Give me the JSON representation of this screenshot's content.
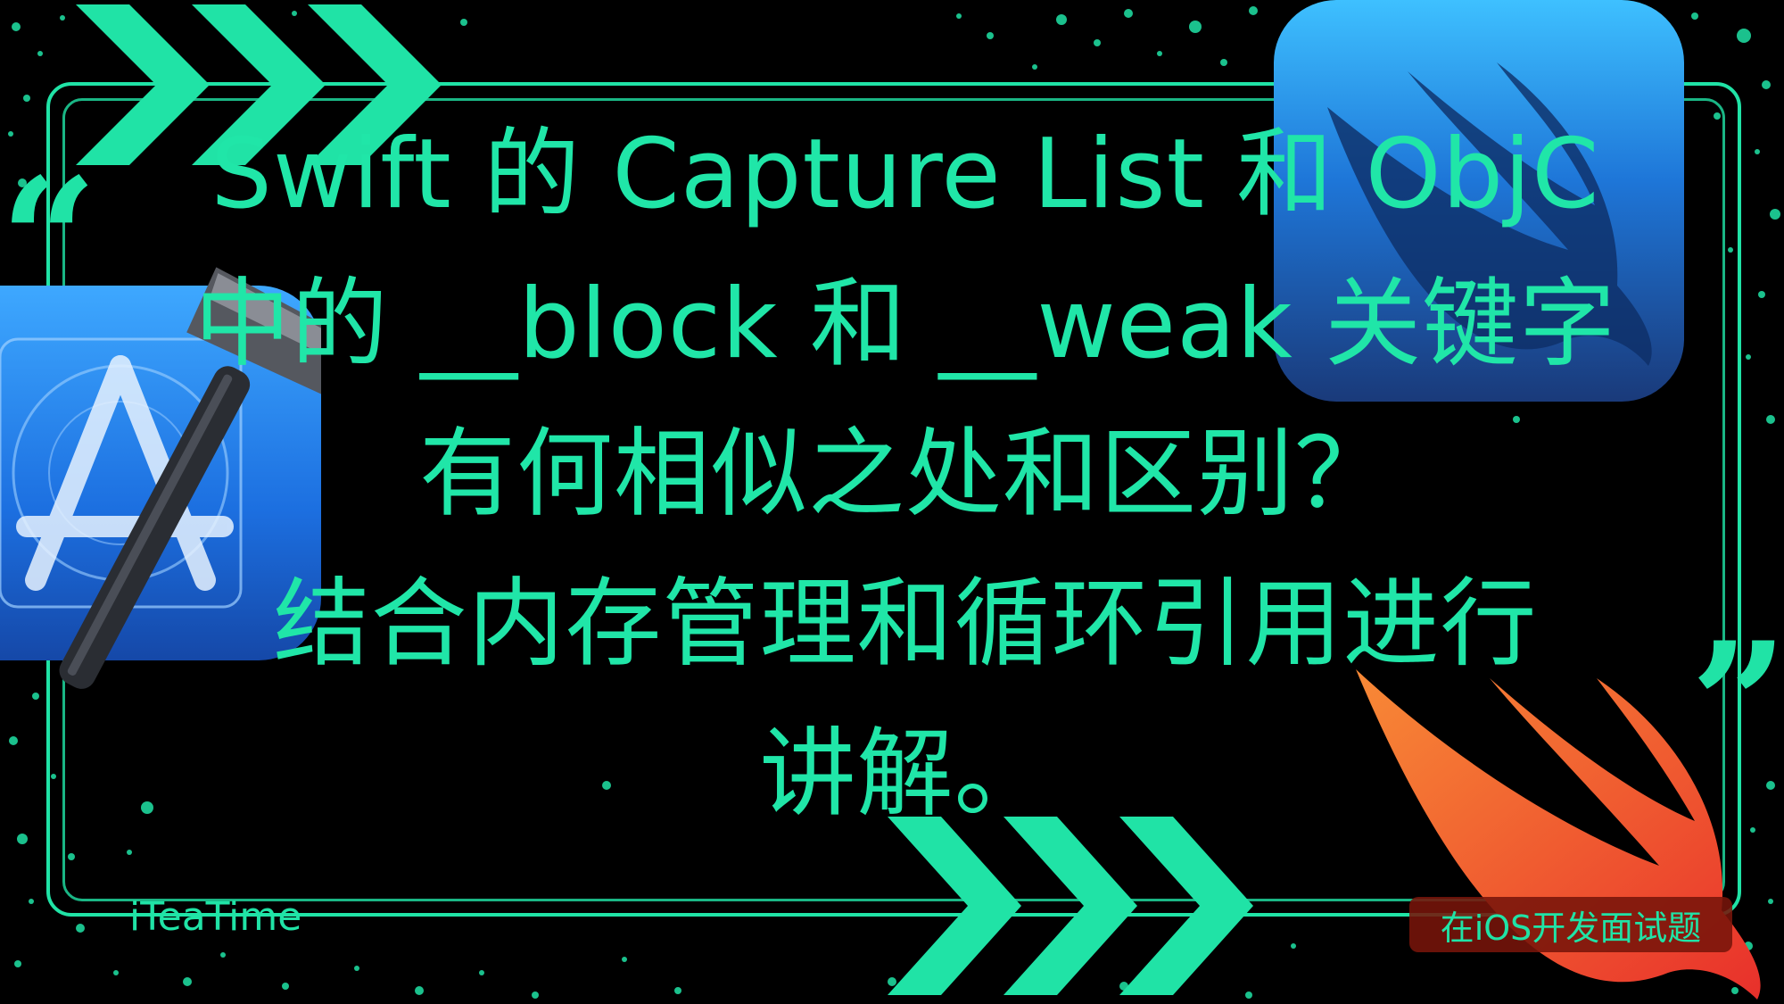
{
  "title": {
    "line1": "Swift 的 Capture List 和 ObjC",
    "line2": "中的 __block 和 __weak 关键字",
    "line3": "有何相似之处和区别？",
    "line4": "结合内存管理和循环引用进行",
    "line5": "讲解。"
  },
  "quotes": {
    "open": "“",
    "close": "”"
  },
  "brand": "iTeaTime",
  "tag": "在iOS开发面试题",
  "icons": {
    "left": "xcode-icon",
    "top_right": "swift-app-icon",
    "bottom_right": "swift-logo",
    "decorations": [
      "chevron-arrows-icon",
      "splatter-dots"
    ]
  },
  "colors": {
    "background": "#000000",
    "accent": "#20e3a6",
    "swift_orange": "#f05138",
    "icon_blue": "#1e76d8"
  }
}
